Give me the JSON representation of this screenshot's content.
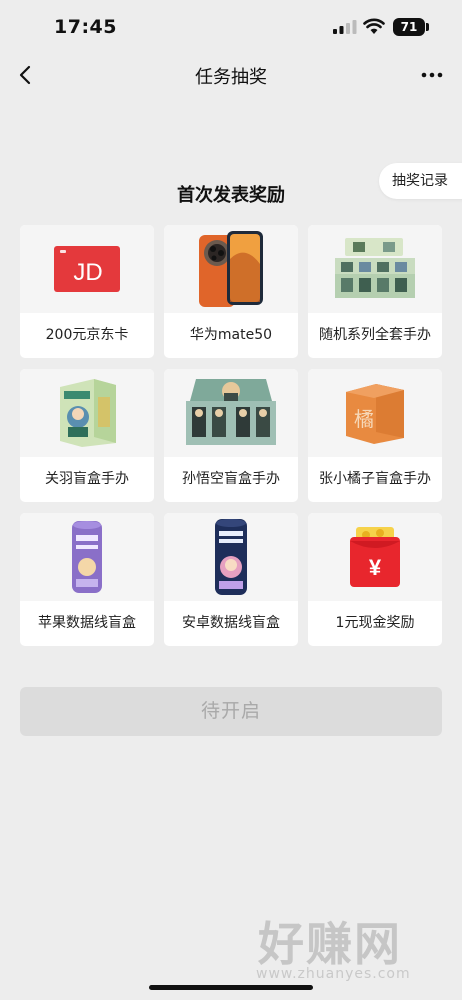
{
  "status_bar": {
    "time": "17:45",
    "battery": "71"
  },
  "nav": {
    "title": "任务抽奖"
  },
  "record_tab": {
    "label": "抽奖记录"
  },
  "section_title": "首次发表奖励",
  "prizes": [
    {
      "name": "200元京东卡",
      "icon": "jd-card-image",
      "jd_text": "JD"
    },
    {
      "name": "华为mate50",
      "icon": "phone-image"
    },
    {
      "name": "随机系列全套手办",
      "icon": "figure-set-box-image"
    },
    {
      "name": "关羽盲盒手办",
      "icon": "blind-box-image"
    },
    {
      "name": "孙悟空盲盒手办",
      "icon": "display-box-image"
    },
    {
      "name": "张小橘子盲盒手办",
      "icon": "orange-box-image",
      "box_char": "橘"
    },
    {
      "name": "苹果数据线盲盒",
      "icon": "cable-tube-purple-image"
    },
    {
      "name": "安卓数据线盲盒",
      "icon": "cable-tube-navy-image"
    },
    {
      "name": "1元现金奖励",
      "icon": "red-envelope-image",
      "yuan": "¥"
    }
  ],
  "action_button": {
    "label": "待开启"
  },
  "watermark": {
    "main": "好赚网",
    "url": "www.zhuanyes.com"
  },
  "colors": {
    "background": "#ededed",
    "jd_red": "#e4393c",
    "envelope_red": "#e8262d",
    "disabled_button": "#dcdcdc"
  }
}
